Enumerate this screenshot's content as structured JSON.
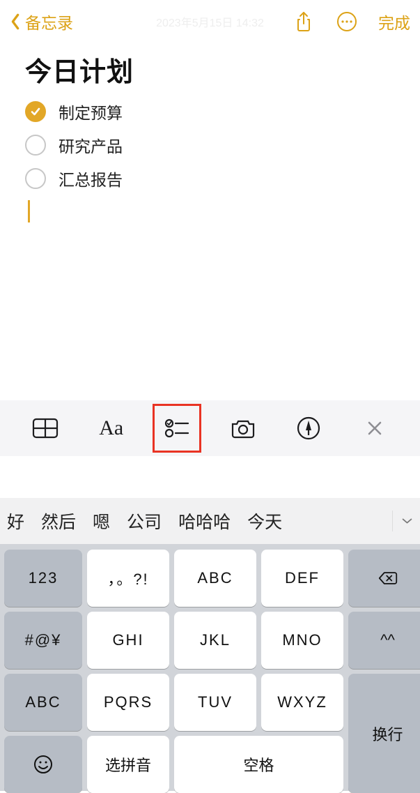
{
  "navbar": {
    "back_label": "备忘录",
    "timestamp": "2023年5月15日 14:32",
    "done_label": "完成"
  },
  "note": {
    "title": "今日计划",
    "items": [
      {
        "label": "制定预算",
        "checked": true
      },
      {
        "label": "研究产品",
        "checked": false
      },
      {
        "label": "汇总报告",
        "checked": false
      }
    ]
  },
  "toolbar": {
    "icons": {
      "table": "table-icon",
      "textformat": "textformat-icon",
      "checklist": "checklist-icon",
      "camera": "camera-icon",
      "markup": "markup-icon",
      "close": "close-icon"
    }
  },
  "suggestions": [
    "好",
    "然后",
    "嗯",
    "公司",
    "哈哈哈",
    "今天"
  ],
  "keyboard": {
    "rows": {
      "r1": [
        "123",
        "，。?!",
        "ABC",
        "DEF"
      ],
      "r2": [
        "#@¥",
        "GHI",
        "JKL",
        "MNO",
        "^^"
      ],
      "r3": [
        "ABC",
        "PQRS",
        "TUV",
        "WXYZ"
      ],
      "r4": [
        "选拼音",
        "空格"
      ]
    },
    "backspace": "⌫",
    "enter": "换行"
  }
}
